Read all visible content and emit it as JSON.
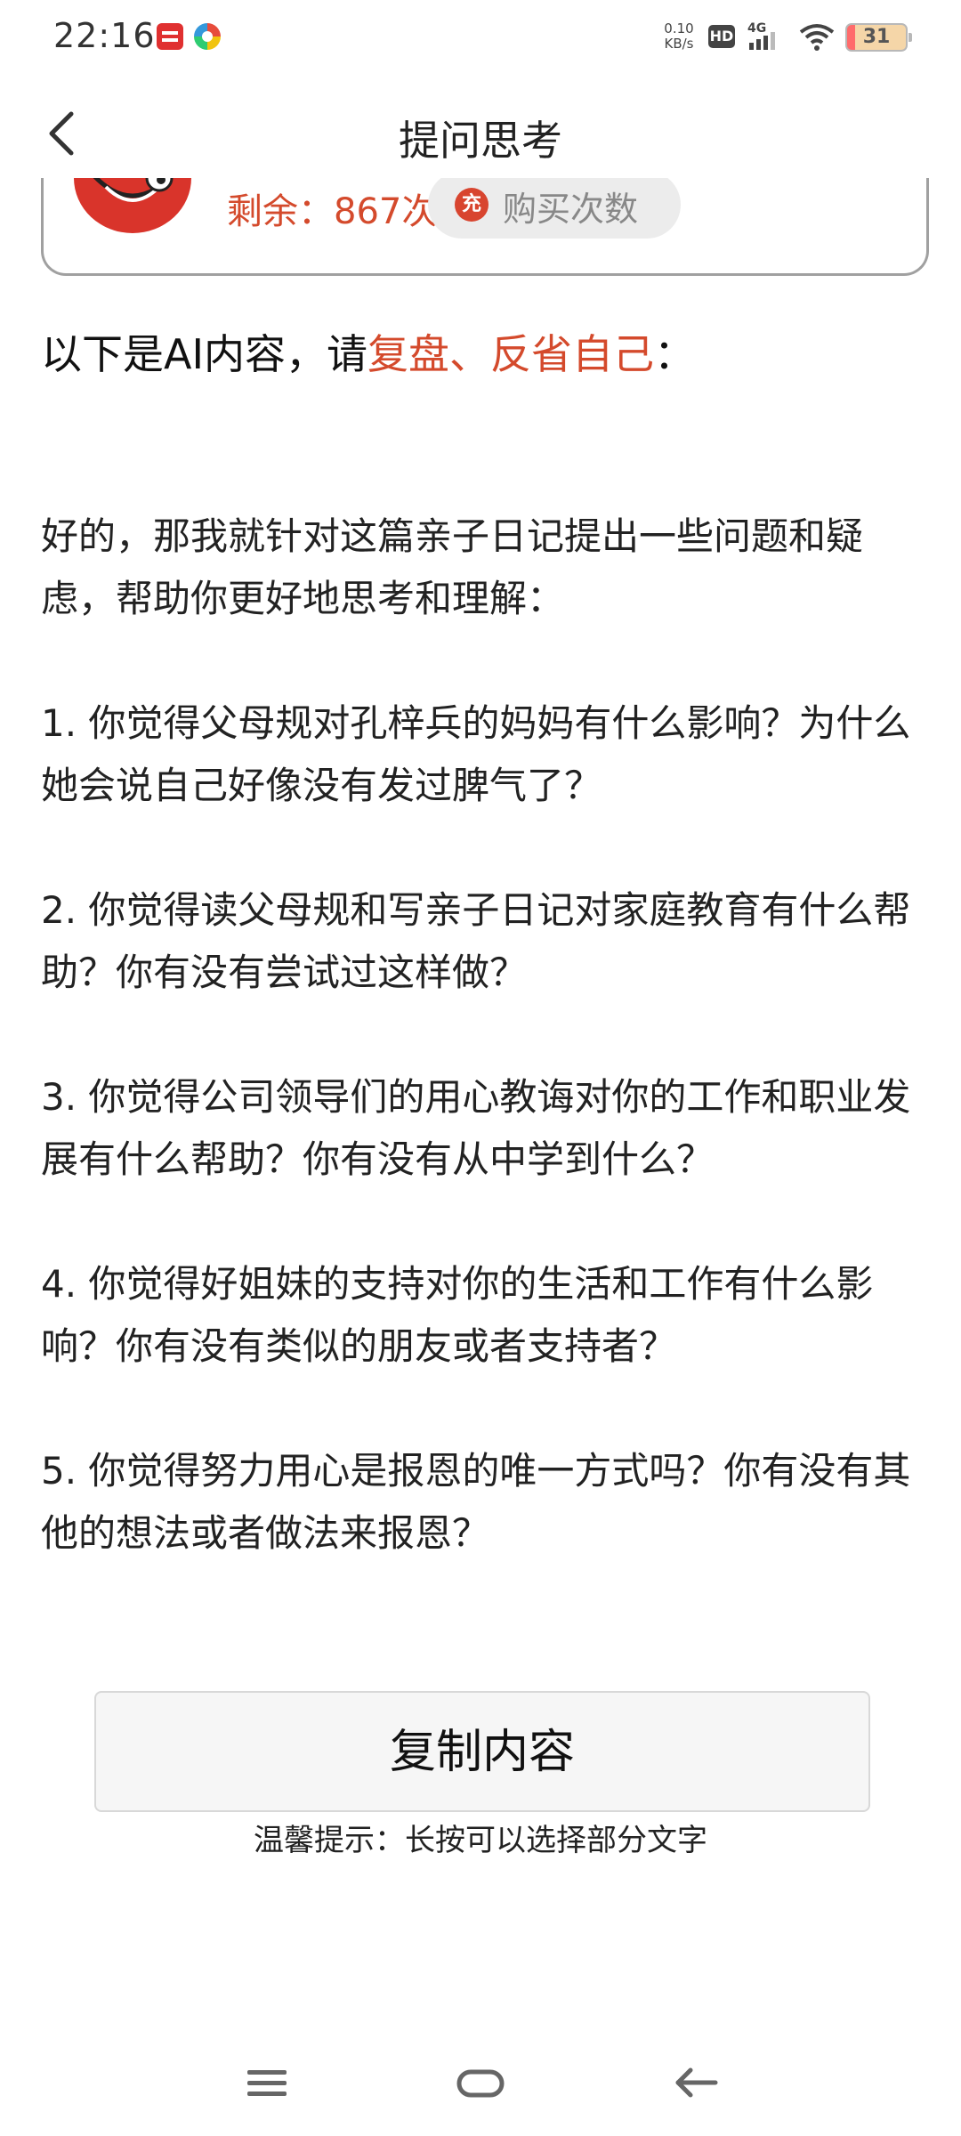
{
  "status_bar": {
    "time": "22:16",
    "network_speed_value": "0.10",
    "network_speed_unit": "KB/s",
    "hd_label": "HD",
    "network_type": "4G",
    "battery_level": "31",
    "icons": [
      "news-app-icon",
      "browser-app-icon",
      "signal-icon",
      "wifi-icon",
      "battery-icon"
    ]
  },
  "nav": {
    "title": "提问思考",
    "back_icon": "chevron-left-icon"
  },
  "quota": {
    "remaining_text": "剩余：867次",
    "charge_icon_text": "充",
    "buy_label": "购买次数"
  },
  "intro": {
    "prefix": "以下是AI内容，请",
    "highlight": "复盘、反省自己",
    "suffix": "："
  },
  "ai_content": {
    "paragraphs": [
      "好的，那我就针对这篇亲子日记提出一些问题和疑虑，帮助你更好地思考和理解：",
      "1. 你觉得父母规对孔梓兵的妈妈有什么影响？为什么她会说自己好像没有发过脾气了？",
      "2. 你觉得读父母规和写亲子日记对家庭教育有什么帮助？你有没有尝试过这样做？",
      "3. 你觉得公司领导们的用心教诲对你的工作和职业发展有什么帮助？你有没有从中学到什么？",
      "4. 你觉得好姐妹的支持对你的生活和工作有什么影响？你有没有类似的朋友或者支持者？",
      "5. 你觉得努力用心是报恩的唯一方式吗？你有没有其他的想法或者做法来报恩？"
    ]
  },
  "actions": {
    "copy_label": "复制内容",
    "tip": "温馨提示：长按可以选择部分文字"
  },
  "system_nav": {
    "icons": [
      "menu-icon",
      "home-icon",
      "back-icon"
    ]
  },
  "colors": {
    "accent": "#d44a2c",
    "text": "#222222",
    "button_bg": "#f6f6f6"
  }
}
